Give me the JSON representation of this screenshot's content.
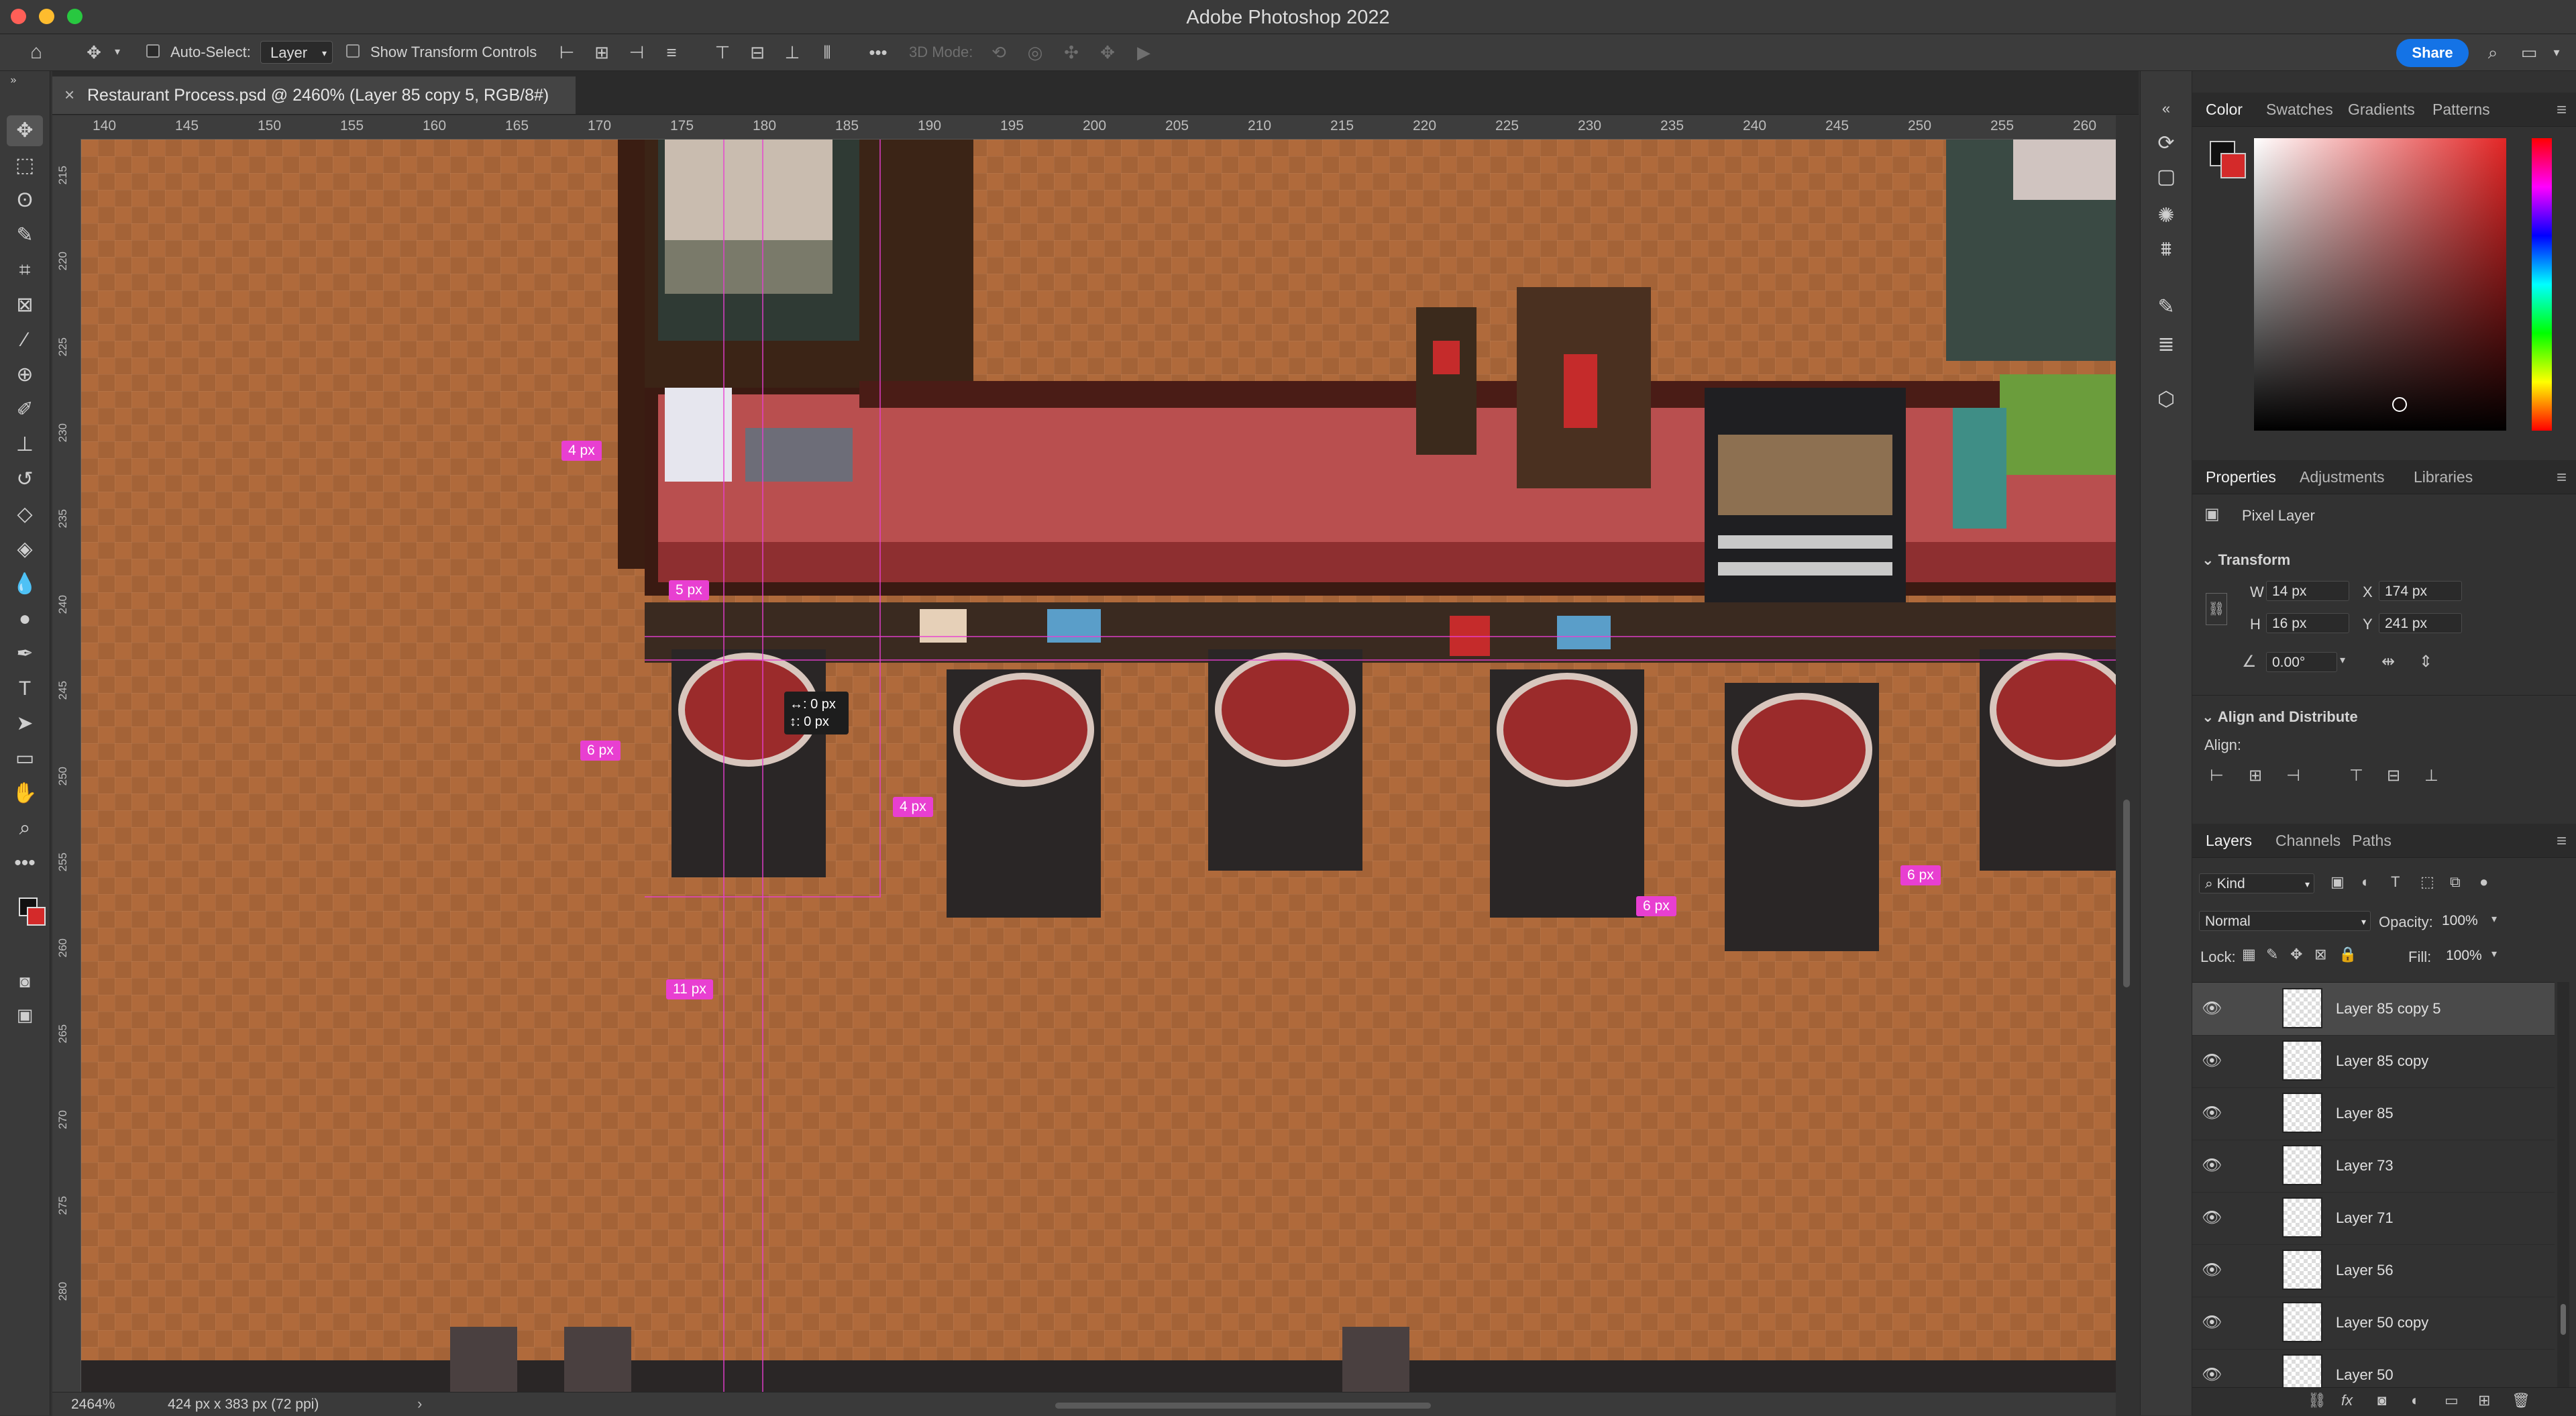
{
  "app": {
    "title": "Adobe Photoshop 2022"
  },
  "options_bar": {
    "auto_select_label": "Auto-Select:",
    "auto_select_target": "Layer",
    "show_transform_label": "Show Transform Controls",
    "three_d_mode_label": "3D Mode:",
    "share_label": "Share"
  },
  "document": {
    "tab_label": "Restaurant Process.psd @ 2460% (Layer 85 copy 5, RGB/8#)",
    "zoom": "2464%",
    "info": "424 px x 383 px (72 ppi)"
  },
  "rulers": {
    "top_ticks": [
      "140",
      "145",
      "150",
      "155",
      "160",
      "165",
      "170",
      "175",
      "180",
      "185",
      "190",
      "195",
      "200",
      "205",
      "210",
      "215",
      "220",
      "225",
      "230",
      "235",
      "240",
      "245",
      "250",
      "255",
      "260"
    ],
    "left_ticks": [
      "215",
      "220",
      "225",
      "230",
      "235",
      "240",
      "245",
      "250",
      "255",
      "260",
      "265",
      "270",
      "275",
      "280"
    ]
  },
  "canvas": {
    "measure_labels": [
      "4 px",
      "5 px",
      "6 px",
      "4 px",
      "11 px",
      "6 px",
      "6 px"
    ],
    "tooltip": "↔: 0 px\n↕: 0 px"
  },
  "color_panel": {
    "tabs": [
      "Color",
      "Swatches",
      "Gradients",
      "Patterns"
    ],
    "foreground": "#111111",
    "background": "#d42a2a",
    "hue": "#e32626"
  },
  "properties_panel": {
    "tabs": [
      "Properties",
      "Adjustments",
      "Libraries"
    ],
    "layer_type": "Pixel Layer",
    "transform_title": "Transform",
    "w_label": "W",
    "w_value": "14 px",
    "h_label": "H",
    "h_value": "16 px",
    "x_label": "X",
    "x_value": "174 px",
    "y_label": "Y",
    "y_value": "241 px",
    "angle_value": "0.00°",
    "align_title": "Align and Distribute",
    "align_label": "Align:"
  },
  "layers_panel": {
    "tabs": [
      "Layers",
      "Channels",
      "Paths"
    ],
    "filter_kind": "Kind",
    "blend_mode": "Normal",
    "opacity_label": "Opacity:",
    "opacity_value": "100%",
    "lock_label": "Lock:",
    "fill_label": "Fill:",
    "fill_value": "100%",
    "layers": [
      "Layer 85 copy 5",
      "Layer 85 copy",
      "Layer 85",
      "Layer 73",
      "Layer 71",
      "Layer 56",
      "Layer 50 copy",
      "Layer 50"
    ],
    "selected_index": 0
  }
}
